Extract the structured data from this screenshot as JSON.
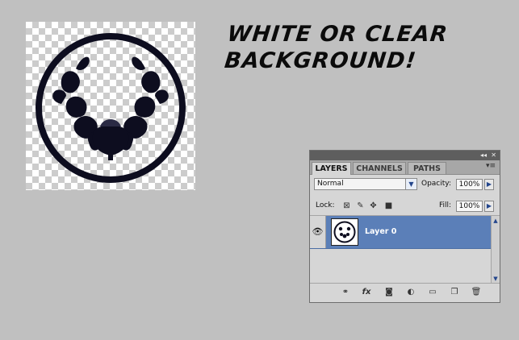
{
  "caption": {
    "line1": "WHITE OR CLEAR",
    "line2": "BACKGROUND!"
  },
  "canvas": {
    "artwork": "crest-icon",
    "art_color": "#0d0d1f",
    "transparency": "checkerboard"
  },
  "layers_panel": {
    "collapse_glyph": "◂◂",
    "close_glyph": "✕",
    "tabs": [
      {
        "label": "LAYERS",
        "active": true
      },
      {
        "label": "CHANNELS",
        "active": false
      },
      {
        "label": "PATHS",
        "active": false
      }
    ],
    "menu_glyph": "▾≡",
    "blend_mode": "Normal",
    "opacity_label": "Opacity:",
    "opacity_value": "100%",
    "lock_label": "Lock:",
    "fill_label": "Fill:",
    "fill_value": "100%",
    "layers": [
      {
        "name": "Layer 0",
        "visible": true,
        "selected": true
      }
    ],
    "footer_icons": [
      "link-icon",
      "fx-icon",
      "mask-icon",
      "adjustment-icon",
      "folder-icon",
      "new-layer-icon",
      "trash-icon"
    ],
    "selection_color": "#5b7fb8"
  }
}
